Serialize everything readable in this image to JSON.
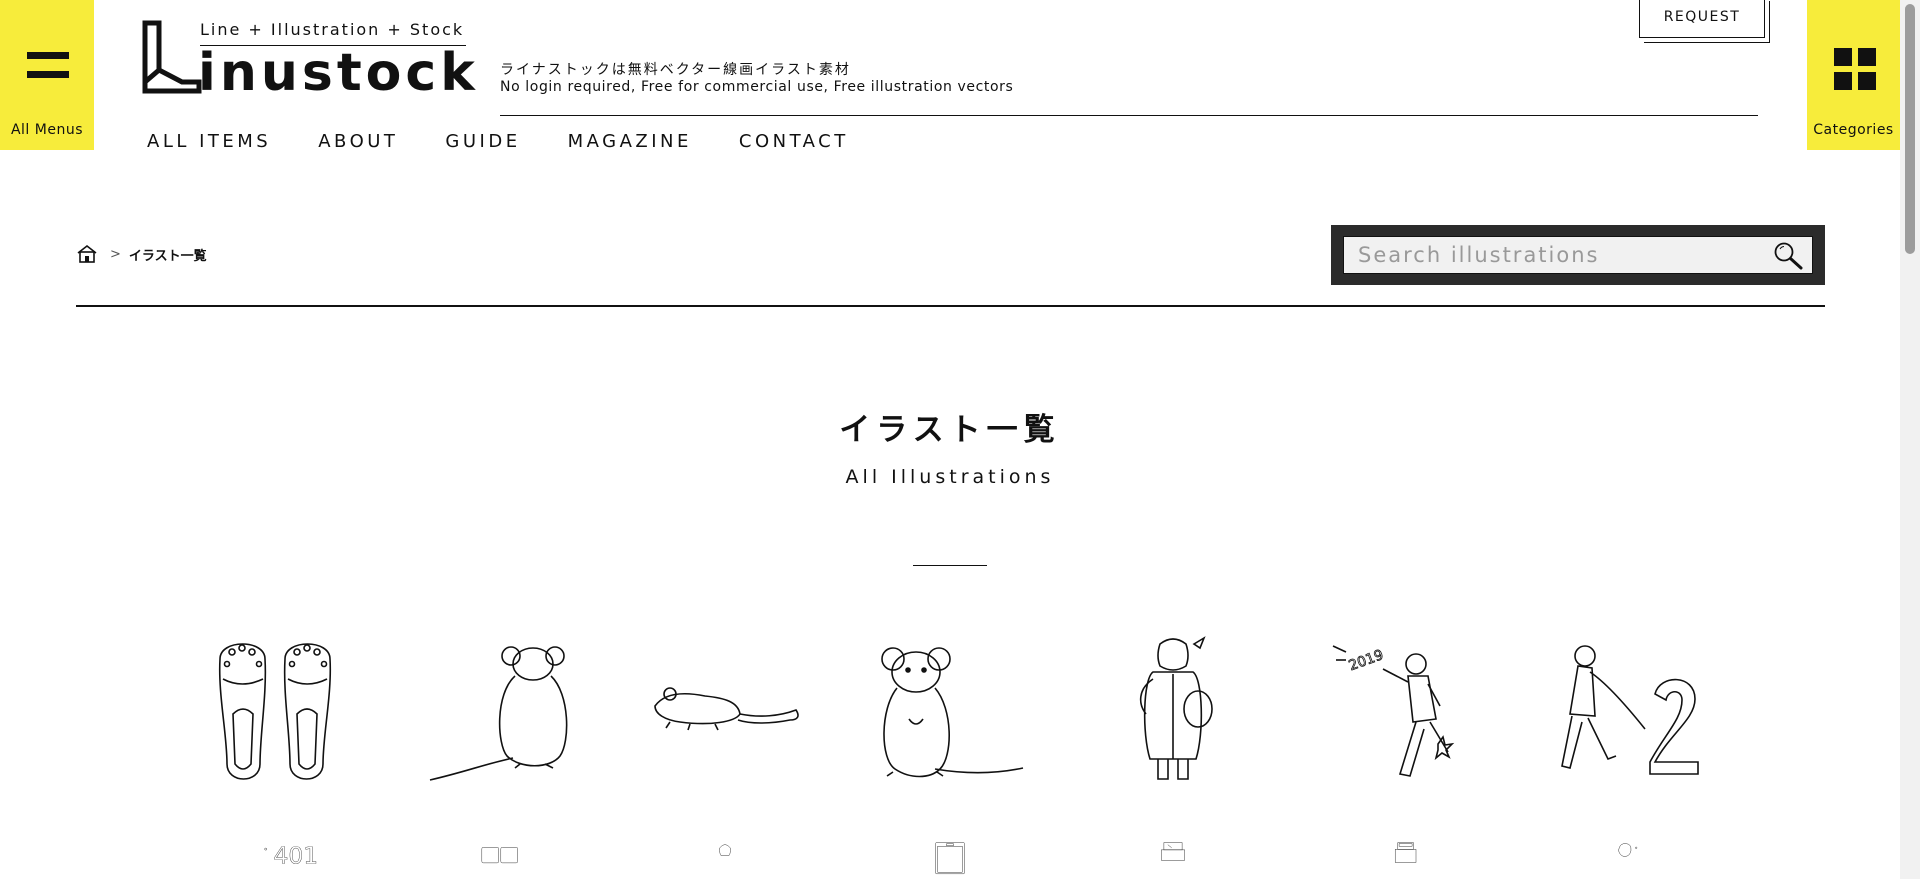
{
  "header": {
    "menu_label": "All Menus",
    "categories_label": "Categories",
    "logo_tagline": "Line + Illustration + Stock",
    "logo_word": "inustock",
    "tagline_jp": "ライナストックは無料ベクター線画イラスト素材",
    "tagline_en": "No login required, Free for commercial use, Free illustration vectors",
    "request_label": "REQUEST",
    "accent_color": "#f7ec3b"
  },
  "nav": {
    "items": [
      {
        "label": "ALL ITEMS"
      },
      {
        "label": "ABOUT"
      },
      {
        "label": "GUIDE"
      },
      {
        "label": "MAGAZINE"
      },
      {
        "label": "CONTACT"
      }
    ]
  },
  "breadcrumb": {
    "home_icon": "home-icon",
    "separator": ">",
    "current": "イラスト一覧"
  },
  "search": {
    "placeholder": "Search illustrations",
    "value": "",
    "icon": "search-icon"
  },
  "page": {
    "title_jp": "イラスト一覧",
    "title_en": "All Illustrations"
  },
  "illustrations": [
    {
      "icon": "crocs-sandals-icon"
    },
    {
      "icon": "mouse-back-view-icon"
    },
    {
      "icon": "mouse-running-icon"
    },
    {
      "icon": "mouse-front-view-icon"
    },
    {
      "icon": "woman-winter-coat-icon"
    },
    {
      "icon": "man-kicking-2019-icon"
    },
    {
      "icon": "man-pulling-number-2-icon"
    },
    {
      "icon": "number-401-icon"
    },
    {
      "icon": "digital-clock-icon"
    },
    {
      "icon": "girl-portrait-icon"
    },
    {
      "icon": "monitor-screen-icon"
    },
    {
      "icon": "cash-register-icon"
    },
    {
      "icon": "ticket-machine-icon"
    },
    {
      "icon": "man-portrait-icon"
    }
  ]
}
